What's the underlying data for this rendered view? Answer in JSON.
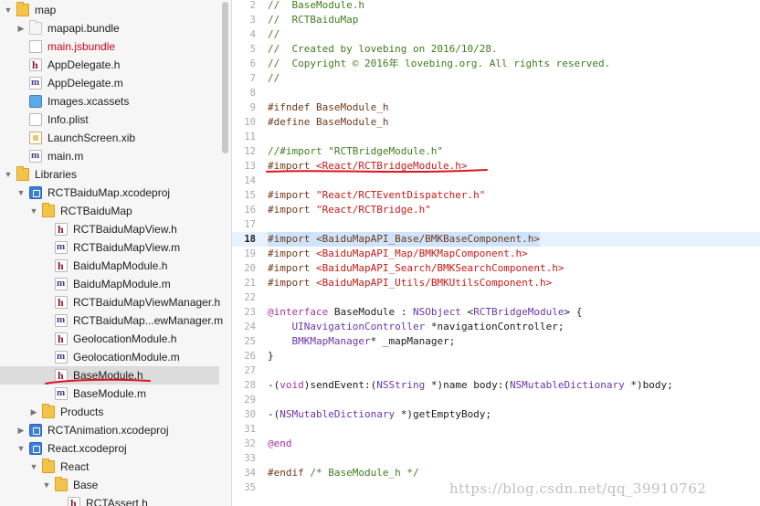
{
  "navigator": {
    "items": [
      {
        "label": "map",
        "icon": "folder-yellow",
        "indent": 0,
        "disclosure": "down",
        "color": "#1e1e1e"
      },
      {
        "label": "mapapi.bundle",
        "icon": "folder-white",
        "indent": 1,
        "disclosure": "right",
        "color": "#1e1e1e"
      },
      {
        "label": "main.jsbundle",
        "icon": "file-doc",
        "indent": 1,
        "disclosure": "",
        "color": "#d0021b"
      },
      {
        "label": "AppDelegate.h",
        "icon": "file-h",
        "indent": 1,
        "disclosure": "",
        "color": "#1e1e1e"
      },
      {
        "label": "AppDelegate.m",
        "icon": "file-m",
        "indent": 1,
        "disclosure": "",
        "color": "#1e1e1e"
      },
      {
        "label": "Images.xcassets",
        "icon": "file-assets",
        "indent": 1,
        "disclosure": "",
        "color": "#1e1e1e"
      },
      {
        "label": "Info.plist",
        "icon": "file-doc",
        "indent": 1,
        "disclosure": "",
        "color": "#1e1e1e"
      },
      {
        "label": "LaunchScreen.xib",
        "icon": "file-xib",
        "indent": 1,
        "disclosure": "",
        "color": "#1e1e1e"
      },
      {
        "label": "main.m",
        "icon": "file-m",
        "indent": 1,
        "disclosure": "",
        "color": "#1e1e1e"
      },
      {
        "label": "Libraries",
        "icon": "folder-yellow",
        "indent": 0,
        "disclosure": "down",
        "color": "#1e1e1e"
      },
      {
        "label": "RCTBaiduMap.xcodeproj",
        "icon": "file-proj",
        "indent": 1,
        "disclosure": "down",
        "color": "#1e1e1e"
      },
      {
        "label": "RCTBaiduMap",
        "icon": "folder-yellow",
        "indent": 2,
        "disclosure": "down",
        "color": "#1e1e1e"
      },
      {
        "label": "RCTBaiduMapView.h",
        "icon": "file-h",
        "indent": 3,
        "disclosure": "",
        "color": "#1e1e1e"
      },
      {
        "label": "RCTBaiduMapView.m",
        "icon": "file-m",
        "indent": 3,
        "disclosure": "",
        "color": "#1e1e1e"
      },
      {
        "label": "BaiduMapModule.h",
        "icon": "file-h",
        "indent": 3,
        "disclosure": "",
        "color": "#1e1e1e"
      },
      {
        "label": "BaiduMapModule.m",
        "icon": "file-m",
        "indent": 3,
        "disclosure": "",
        "color": "#1e1e1e"
      },
      {
        "label": "RCTBaiduMapViewManager.h",
        "icon": "file-h",
        "indent": 3,
        "disclosure": "",
        "color": "#1e1e1e"
      },
      {
        "label": "RCTBaiduMap...ewManager.m",
        "icon": "file-m",
        "indent": 3,
        "disclosure": "",
        "color": "#1e1e1e"
      },
      {
        "label": "GeolocationModule.h",
        "icon": "file-h",
        "indent": 3,
        "disclosure": "",
        "color": "#1e1e1e"
      },
      {
        "label": "GeolocationModule.m",
        "icon": "file-m",
        "indent": 3,
        "disclosure": "",
        "color": "#1e1e1e"
      },
      {
        "label": "BaseModule.h",
        "icon": "file-h",
        "indent": 3,
        "disclosure": "",
        "color": "#1e1e1e",
        "selected": true
      },
      {
        "label": "BaseModule.m",
        "icon": "file-m",
        "indent": 3,
        "disclosure": "",
        "color": "#1e1e1e"
      },
      {
        "label": "Products",
        "icon": "folder-yellow",
        "indent": 2,
        "disclosure": "right",
        "color": "#1e1e1e"
      },
      {
        "label": "RCTAnimation.xcodeproj",
        "icon": "file-proj",
        "indent": 1,
        "disclosure": "right",
        "color": "#1e1e1e"
      },
      {
        "label": "React.xcodeproj",
        "icon": "file-proj",
        "indent": 1,
        "disclosure": "down",
        "color": "#1e1e1e"
      },
      {
        "label": "React",
        "icon": "folder-yellow",
        "indent": 2,
        "disclosure": "down",
        "color": "#1e1e1e"
      },
      {
        "label": "Base",
        "icon": "folder-yellow",
        "indent": 3,
        "disclosure": "down",
        "color": "#1e1e1e"
      },
      {
        "label": "RCTAssert.h",
        "icon": "file-h",
        "indent": 4,
        "disclosure": "",
        "color": "#1e1e1e"
      }
    ]
  },
  "editor": {
    "current_line": 18,
    "lines": [
      {
        "n": "2",
        "tokens": [
          [
            "c",
            "//  BaseModule.h"
          ]
        ]
      },
      {
        "n": "3",
        "tokens": [
          [
            "c",
            "//  RCTBaiduMap"
          ]
        ]
      },
      {
        "n": "4",
        "tokens": [
          [
            "c",
            "//"
          ]
        ]
      },
      {
        "n": "5",
        "tokens": [
          [
            "c",
            "//  Created by lovebing on 2016/10/28."
          ]
        ]
      },
      {
        "n": "6",
        "tokens": [
          [
            "c",
            "//  Copyright © 2016年 lovebing.org. All rights reserved."
          ]
        ]
      },
      {
        "n": "7",
        "tokens": [
          [
            "c",
            "//"
          ]
        ]
      },
      {
        "n": "8",
        "tokens": []
      },
      {
        "n": "9",
        "tokens": [
          [
            "p",
            "#ifndef BaseModule_h"
          ]
        ]
      },
      {
        "n": "10",
        "tokens": [
          [
            "p",
            "#define BaseModule_h"
          ]
        ]
      },
      {
        "n": "11",
        "tokens": []
      },
      {
        "n": "12",
        "tokens": [
          [
            "c",
            "//#import \"RCTBridgeModule.h\""
          ]
        ]
      },
      {
        "n": "13",
        "tokens": [
          [
            "p",
            "#import "
          ],
          [
            "s",
            "<React/RCTBridgeModule.h>"
          ]
        ]
      },
      {
        "n": "14",
        "tokens": []
      },
      {
        "n": "15",
        "tokens": [
          [
            "p",
            "#import "
          ],
          [
            "s",
            "\"React/RCTEventDispatcher.h\""
          ]
        ]
      },
      {
        "n": "16",
        "tokens": [
          [
            "p",
            "#import "
          ],
          [
            "s",
            "\"React/RCTBridge.h\""
          ]
        ]
      },
      {
        "n": "17",
        "tokens": []
      },
      {
        "n": "18",
        "tokens": [
          [
            "p",
            "#import <BaiduMapAPI_Base/BMKBaseComponent.h>"
          ]
        ]
      },
      {
        "n": "19",
        "tokens": [
          [
            "p",
            "#import "
          ],
          [
            "s",
            "<BaiduMapAPI_Map/BMKMapComponent.h>"
          ]
        ]
      },
      {
        "n": "20",
        "tokens": [
          [
            "p",
            "#import "
          ],
          [
            "s",
            "<BaiduMapAPI_Search/BMKSearchComponent.h>"
          ]
        ]
      },
      {
        "n": "21",
        "tokens": [
          [
            "p",
            "#import "
          ],
          [
            "s",
            "<BaiduMapAPI_Utils/BMKUtilsComponent.h>"
          ]
        ]
      },
      {
        "n": "22",
        "tokens": []
      },
      {
        "n": "23",
        "tokens": [
          [
            "k",
            "@interface"
          ],
          [
            "t",
            " BaseModule : "
          ],
          [
            "y",
            "NSObject"
          ],
          [
            "t",
            " <"
          ],
          [
            "y",
            "RCTBridgeModule"
          ],
          [
            "t",
            "> {"
          ]
        ]
      },
      {
        "n": "24",
        "tokens": [
          [
            "t",
            "    "
          ],
          [
            "y",
            "UINavigationController"
          ],
          [
            "t",
            " *navigationController;"
          ]
        ]
      },
      {
        "n": "25",
        "tokens": [
          [
            "t",
            "    "
          ],
          [
            "y",
            "BMKMapManager"
          ],
          [
            "t",
            "* _mapManager;"
          ]
        ]
      },
      {
        "n": "26",
        "tokens": [
          [
            "t",
            "}"
          ]
        ]
      },
      {
        "n": "27",
        "tokens": []
      },
      {
        "n": "28",
        "tokens": [
          [
            "t",
            "-("
          ],
          [
            "k",
            "void"
          ],
          [
            "t",
            ")sendEvent:("
          ],
          [
            "y",
            "NSString"
          ],
          [
            "t",
            " *)name body:("
          ],
          [
            "y",
            "NSMutableDictionary"
          ],
          [
            "t",
            " *)body;"
          ]
        ]
      },
      {
        "n": "29",
        "tokens": []
      },
      {
        "n": "30",
        "tokens": [
          [
            "t",
            "-("
          ],
          [
            "y",
            "NSMutableDictionary"
          ],
          [
            "t",
            " *)getEmptyBody;"
          ]
        ]
      },
      {
        "n": "31",
        "tokens": []
      },
      {
        "n": "32",
        "tokens": [
          [
            "k",
            "@end"
          ]
        ]
      },
      {
        "n": "33",
        "tokens": []
      },
      {
        "n": "34",
        "tokens": [
          [
            "p",
            "#endif "
          ],
          [
            "c",
            "/* BaseModule_h */"
          ]
        ]
      },
      {
        "n": "35",
        "tokens": []
      }
    ]
  },
  "watermark": {
    "text": "https://blog.csdn.net/qq_39910762"
  },
  "colors": {
    "annotation_red": "#e0141e",
    "selection": "#dcdcdc",
    "current_line": "#e8f2fe"
  },
  "icons": [
    "folder-icon",
    "header-file-icon",
    "implementation-file-icon",
    "xcodeproj-icon",
    "xib-file-icon",
    "assets-icon",
    "document-icon",
    "disclosure-triangle-icon"
  ]
}
